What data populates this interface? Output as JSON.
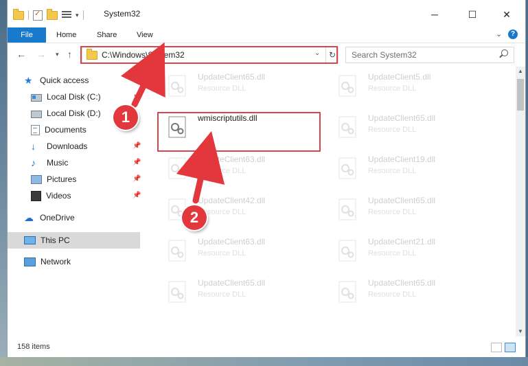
{
  "window": {
    "title": "System32"
  },
  "ribbon": {
    "tabs": [
      {
        "label": "File"
      },
      {
        "label": "Home"
      },
      {
        "label": "Share"
      },
      {
        "label": "View"
      }
    ]
  },
  "nav": {
    "address": "C:\\Windows\\System32",
    "search_placeholder": "Search System32"
  },
  "sidebar": {
    "items": [
      {
        "label": "Quick access"
      },
      {
        "label": "Local Disk (C:)"
      },
      {
        "label": "Local Disk (D:)"
      },
      {
        "label": "Documents"
      },
      {
        "label": "Downloads"
      },
      {
        "label": "Music"
      },
      {
        "label": "Pictures"
      },
      {
        "label": "Videos"
      },
      {
        "label": "OneDrive"
      },
      {
        "label": "This PC"
      },
      {
        "label": "Network"
      }
    ]
  },
  "files": {
    "left": [
      {
        "name": "UpdateClient65.dll",
        "type": "Resource DLL"
      },
      {
        "name": "wmiscriptutils.dll",
        "type": ""
      },
      {
        "name": "UpdateClient63.dll",
        "type": "Resource DLL"
      },
      {
        "name": "UpdateClient42.dll",
        "type": "Resource DLL"
      },
      {
        "name": "UpdateClient63.dll",
        "type": "Resource DLL"
      },
      {
        "name": "UpdateClient65.dll",
        "type": "Resource DLL"
      }
    ],
    "right": [
      {
        "name": "UpdateClient5.dll",
        "type": "Resource DLL"
      },
      {
        "name": "UpdateClient65.dll",
        "type": "Resource DLL"
      },
      {
        "name": "UpdateClient19.dll",
        "type": "Resource DLL"
      },
      {
        "name": "UpdateClient65.dll",
        "type": "Resource DLL"
      },
      {
        "name": "UpdateClient21.dll",
        "type": "Resource DLL"
      },
      {
        "name": "UpdateClient65.dll",
        "type": "Resource DLL"
      }
    ]
  },
  "status": {
    "count": "158 items"
  },
  "annotations": {
    "step1": "1",
    "step2": "2",
    "color": "#e2373c"
  }
}
